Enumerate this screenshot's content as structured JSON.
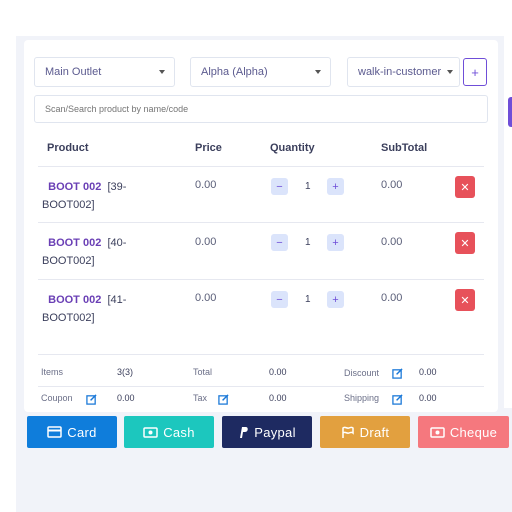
{
  "filters": {
    "outlet": "Main Outlet",
    "warehouse": "Alpha (Alpha)",
    "customer": "walk-in-customer",
    "add_label": "+"
  },
  "search": {
    "placeholder": "Scan/Search product by name/code"
  },
  "table": {
    "headers": {
      "product": "Product",
      "price": "Price",
      "quantity": "Quantity",
      "subtotal": "SubTotal"
    },
    "rows": [
      {
        "code": "BOOT 002",
        "size": "[39-",
        "sku": "BOOT002]",
        "price": "0.00",
        "qty": "1",
        "subtotal": "0.00"
      },
      {
        "code": "BOOT 002",
        "size": "[40-",
        "sku": "BOOT002]",
        "price": "0.00",
        "qty": "1",
        "subtotal": "0.00"
      },
      {
        "code": "BOOT 002",
        "size": "[41-",
        "sku": "BOOT002]",
        "price": "0.00",
        "qty": "1",
        "subtotal": "0.00"
      }
    ]
  },
  "summary": {
    "items_label": "Items",
    "items_value": "3(3)",
    "total_label": "Total",
    "total_value": "0.00",
    "discount_label": "Discount",
    "discount_value": "0.00",
    "coupon_label": "Coupon",
    "coupon_value": "0.00",
    "tax_label": "Tax",
    "tax_value": "0.00",
    "shipping_label": "Shipping",
    "shipping_value": "0.00"
  },
  "payment": {
    "card": "Card",
    "cash": "Cash",
    "paypal": "Paypal",
    "draft": "Draft",
    "cheque": "Cheque"
  },
  "colors": {
    "accent": "#6f4ed8",
    "card": "#0f7ddb",
    "cash": "#1cc7be",
    "paypal": "#1e2a61",
    "draft": "#e2a03f",
    "cheque": "#f5787e",
    "delete": "#e7515a"
  }
}
